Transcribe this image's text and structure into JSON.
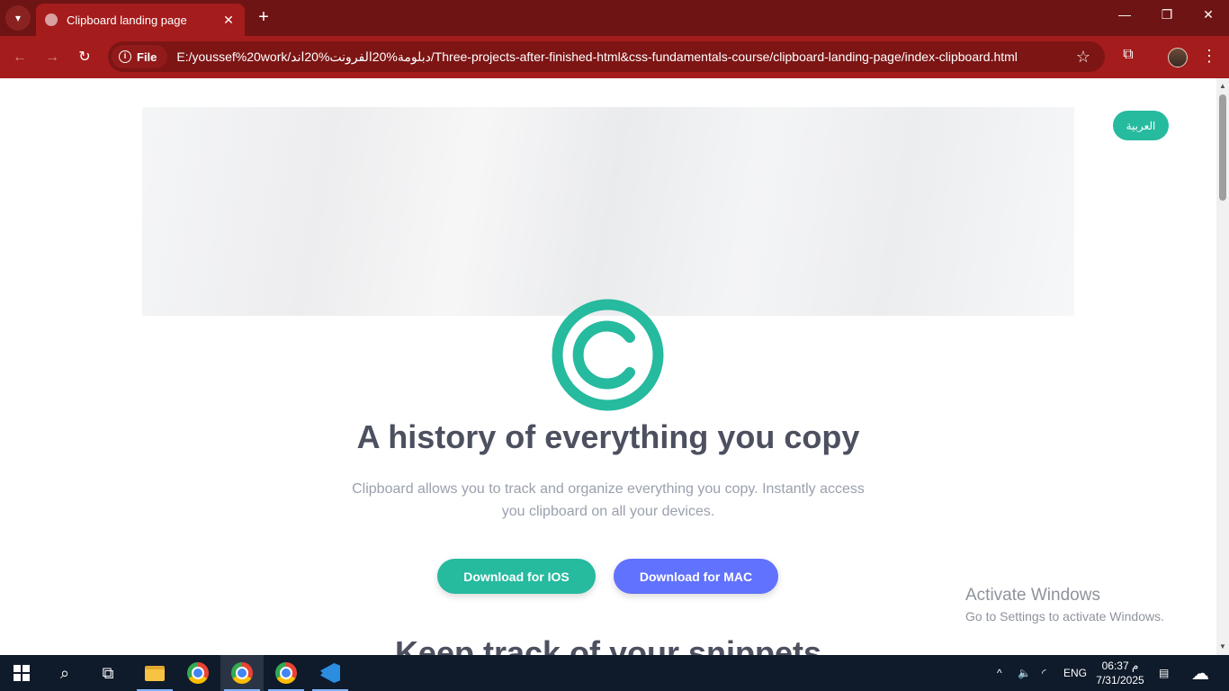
{
  "browser": {
    "tab_title": "Clipboard landing page",
    "new_tab_symbol": "+",
    "file_chip": "File",
    "url": "E:/youssef%20work/دبلومة%20الفرونت%20اند/Three-projects-after-finished-html&css-fundamentals-course/clipboard-landing-page/index-clipboard.html"
  },
  "page": {
    "lang_button": "العربية",
    "headline": "A history of everything you copy",
    "subtitle": "Clipboard allows you to track and organize everything you copy. Instantly access you clipboard on all your devices.",
    "ios_button": "Download for IOS",
    "mac_button": "Download for MAC",
    "next_section_title": "Keep track of your snippets",
    "colors": {
      "accent": "#26ba9f",
      "mac_button": "#6172fe",
      "heading": "#4c505f",
      "body_text": "#9aa0ad"
    }
  },
  "watermark": {
    "line1": "Activate Windows",
    "line2": "Go to Settings to activate Windows."
  },
  "taskbar": {
    "language": "ENG",
    "time": "06:37 م",
    "date": "7/31/2025"
  }
}
